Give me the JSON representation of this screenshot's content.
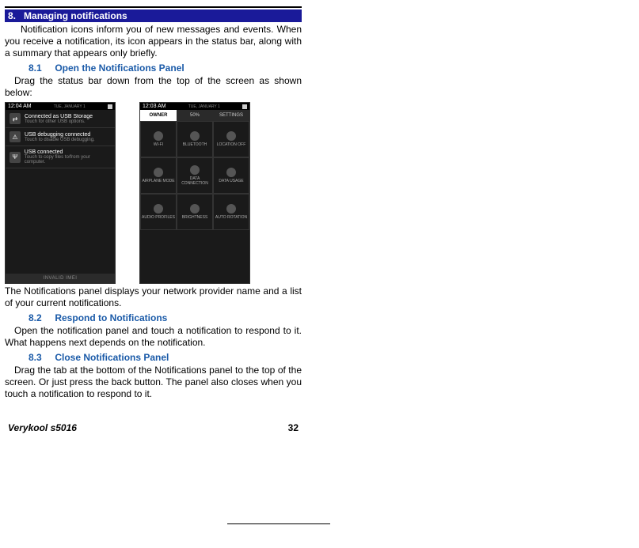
{
  "section": {
    "num": "8.",
    "title": "Managing notifications"
  },
  "intro": "Notification icons inform you of new messages and events. When you receive a notification, its icon appears in the status bar, along with a summary that appears only briefly.",
  "s81": {
    "num": "8.1",
    "title": "Open the Notifications Panel",
    "body": "Drag the status bar down from the top of the screen as shown below:",
    "after": "The Notifications panel displays your network provider name and a list of your current notifications."
  },
  "s82": {
    "num": "8.2",
    "title": "Respond to Notifications",
    "body": "Open the notification panel and touch a notification to respond to it. What happens next depends on the notification."
  },
  "s83": {
    "num": "8.3",
    "title": "Close Notifications Panel",
    "body": "Drag the tab at the bottom of the Notifications panel to the top of the screen. Or just press the back button. The panel also closes when you touch a notification to respond to it."
  },
  "fig": {
    "left": {
      "time": "12:04 AM",
      "date": "TUE, JANUARY 1",
      "items": [
        {
          "icon": "⇄",
          "title": "Connected as USB Storage",
          "sub": "Touch for other USB options."
        },
        {
          "icon": "⚠",
          "title": "USB debugging connected",
          "sub": "Touch to disable USB debugging."
        },
        {
          "icon": "Ψ",
          "title": "USB connected",
          "sub": "Touch to copy files to/from your computer."
        }
      ],
      "footer": "INVALID IMEI"
    },
    "right": {
      "time": "12:03 AM",
      "date": "TUE, JANUARY 1",
      "header": [
        "OWNER",
        "50%",
        "SETTINGS"
      ],
      "tiles": [
        "WI-FI",
        "BLUETOOTH",
        "LOCATION OFF",
        "AIRPLANE MODE",
        "DATA CONNECTION",
        "DATA USAGE",
        "AUDIO PROFILES",
        "BRIGHTNESS",
        "AUTO ROTATION"
      ]
    }
  },
  "footer": {
    "device": "Verykool s5016",
    "page": "32"
  }
}
